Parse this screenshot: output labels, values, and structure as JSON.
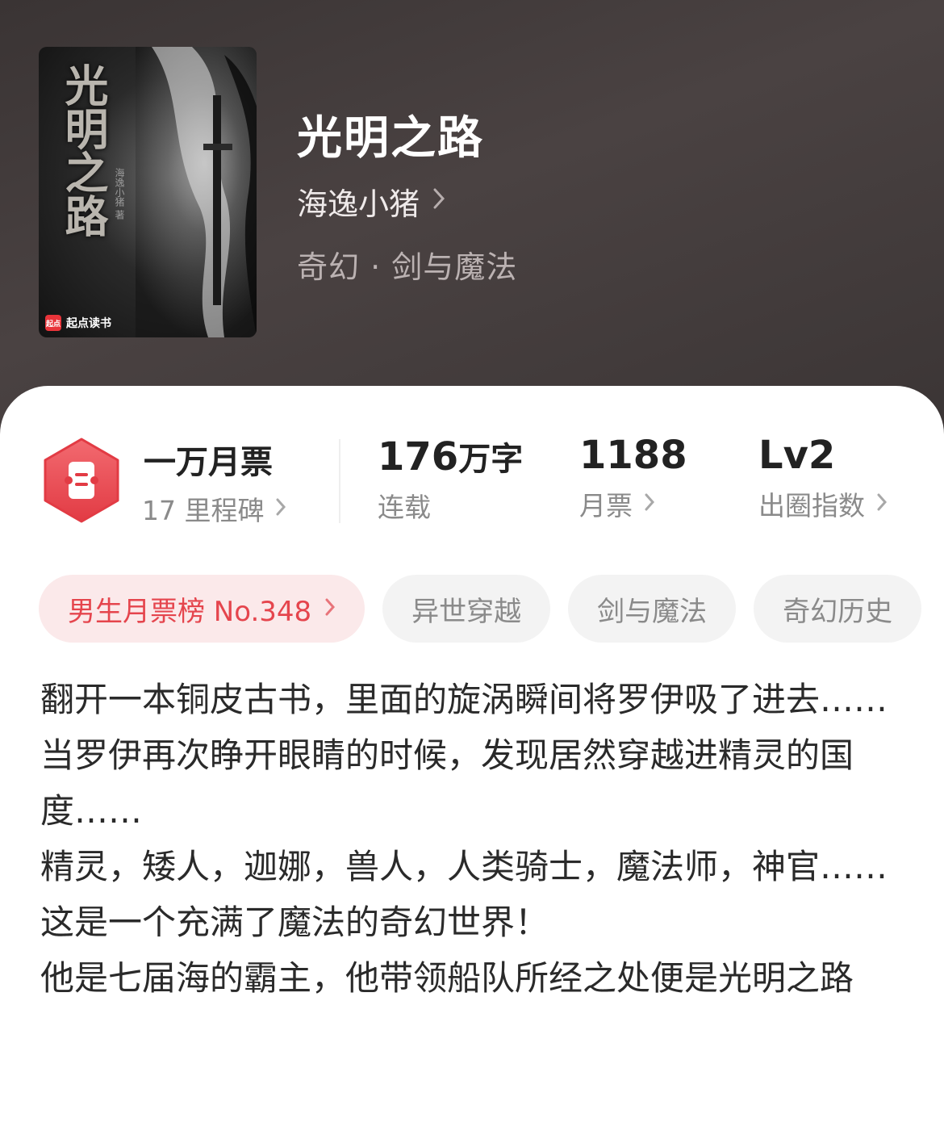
{
  "book": {
    "title": "光明之路",
    "author": "海逸小猪",
    "genre": "奇幻 · 剑与魔法",
    "cover": {
      "title": "光明之路",
      "author": "海逸小猪 著",
      "brand": "起点读书",
      "brand_logo": "起点"
    }
  },
  "stats": {
    "ticket": {
      "main": "一万月票",
      "sub": "17 里程碑"
    },
    "words": {
      "value": "176",
      "unit": "万字",
      "label": "连载"
    },
    "monthly": {
      "value": "1188",
      "label": "月票"
    },
    "influence": {
      "value": "Lv2",
      "label": "出圈指数"
    }
  },
  "tags": [
    {
      "label": "男生月票榜 No.348"
    },
    {
      "label": "异世穿越"
    },
    {
      "label": "剑与魔法"
    },
    {
      "label": "奇幻历史"
    }
  ],
  "description": [
    "翻开一本铜皮古书，里面的旋涡瞬间将罗伊吸了进去……",
    "当罗伊再次睁开眼睛的时候，发现居然穿越进精灵的国度……",
    "精灵，矮人，迦娜，兽人，人类骑士，魔法师，神官……这是一个充满了魔法的奇幻世界！",
    "他是七届海的霸主，他带领船队所经之处便是光明之路"
  ],
  "colors": {
    "accent": "#e5454d",
    "header_bg": "#3f3838",
    "tag_bg": "#f3f3f3",
    "rank_tag_bg": "#fbe9ea"
  },
  "icons": {
    "ticket": "ticket-hexagon-icon",
    "chevron": "chevron-right-icon"
  }
}
